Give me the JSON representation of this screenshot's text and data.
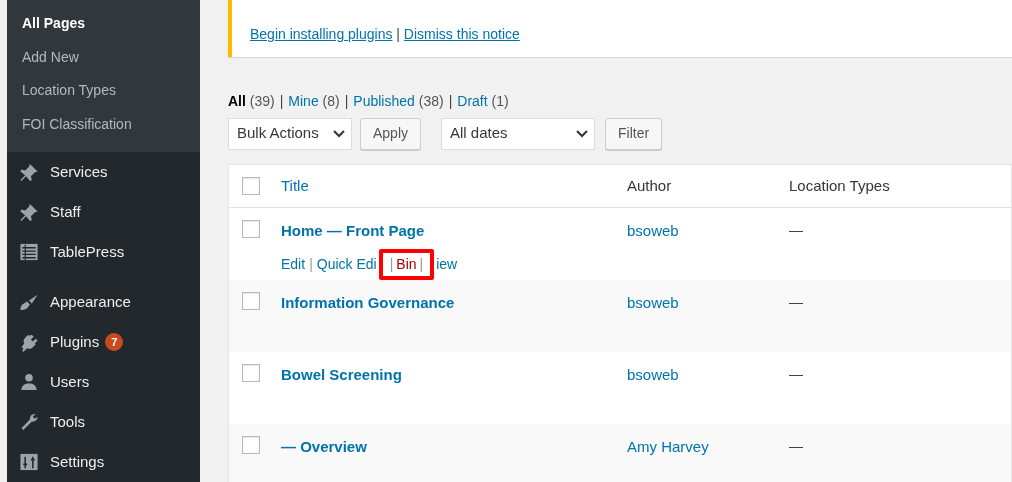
{
  "sidebar": {
    "submenu": [
      {
        "label": "All Pages",
        "selected": true
      },
      {
        "label": "Add New",
        "selected": false
      },
      {
        "label": "Location Types",
        "selected": false
      },
      {
        "label": "FOI Classification",
        "selected": false
      }
    ],
    "items": [
      {
        "label": "Services"
      },
      {
        "label": "Staff"
      },
      {
        "label": "TablePress"
      },
      {
        "label": "Appearance",
        "separator_before": true
      },
      {
        "label": "Plugins",
        "badge": "7"
      },
      {
        "label": "Users"
      },
      {
        "label": "Tools"
      },
      {
        "label": "Settings"
      }
    ]
  },
  "notice": {
    "links": [
      "Begin installing plugins",
      "Dismiss this notice"
    ],
    "separator": "|"
  },
  "views": [
    {
      "label": "All",
      "count": "(39)",
      "selected": true
    },
    {
      "label": "Mine",
      "count": "(8)",
      "selected": false
    },
    {
      "label": "Published",
      "count": "(38)",
      "selected": false
    },
    {
      "label": "Draft",
      "count": "(1)",
      "selected": false
    }
  ],
  "view_separator": "|",
  "bulk_actions": {
    "value": "Bulk Actions",
    "button": "Apply"
  },
  "date_filter": {
    "value": "All dates",
    "button": "Filter"
  },
  "table": {
    "columns": [
      "Title",
      "Author",
      "Location Types"
    ],
    "select_all_checked": false,
    "action_separator": "|",
    "rows": [
      {
        "title": "Home — Front Page",
        "author": "bsoweb",
        "location_types": "—",
        "checked": false,
        "actions": [
          {
            "label": "Edit",
            "highlighted": false
          },
          {
            "label": "Quick Edi",
            "highlighted": false
          },
          {
            "label": "Bin",
            "highlighted": true
          },
          {
            "label": "iew",
            "highlighted": false
          }
        ]
      },
      {
        "title": "Information Governance",
        "author": "bsoweb",
        "location_types": "—",
        "checked": false
      },
      {
        "title": "Bowel Screening",
        "author": "bsoweb",
        "location_types": "—",
        "checked": false
      },
      {
        "title": "— Overview",
        "author": "Amy Harvey",
        "location_types": "—",
        "checked": false
      }
    ]
  }
}
